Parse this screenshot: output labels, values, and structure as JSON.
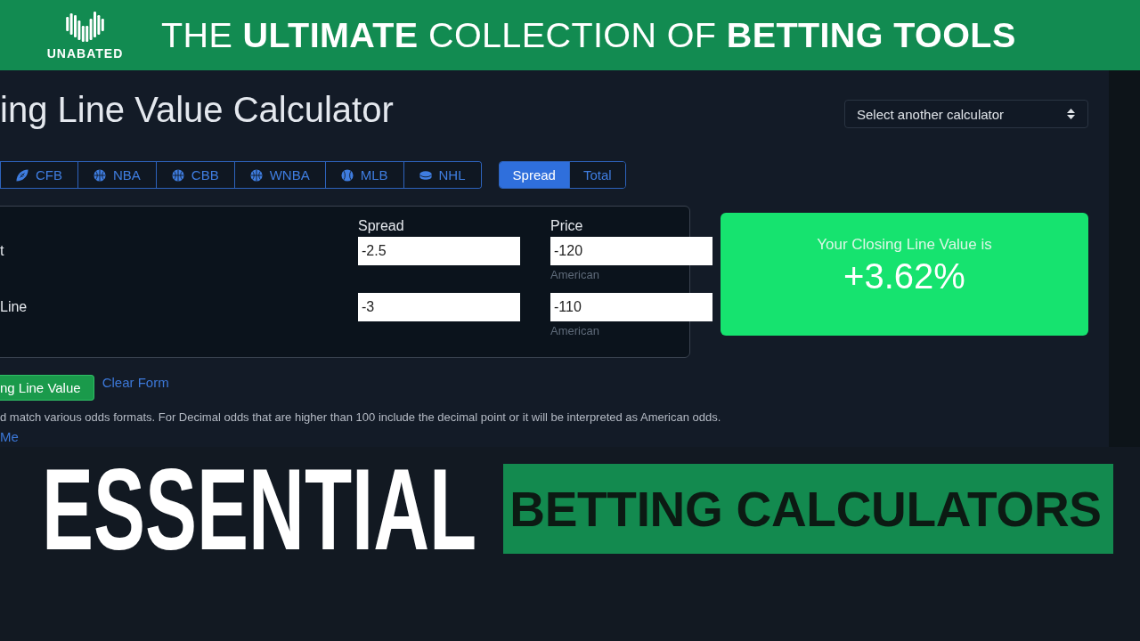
{
  "banner": {
    "logo_text": "UNABATED",
    "headline": "THE **ULTIMATE** COLLECTION OF **BETTING TOOLS**"
  },
  "calculator": {
    "title": "ing Line Value Calculator",
    "calculator_select": {
      "label": "Select another calculator"
    },
    "sport_tabs": [
      {
        "label": "CFB",
        "kind": "football",
        "selected": false
      },
      {
        "label": "NBA",
        "kind": "basketball",
        "selected": false
      },
      {
        "label": "CBB",
        "kind": "basketball",
        "selected": false
      },
      {
        "label": "WNBA",
        "kind": "basketball",
        "selected": false
      },
      {
        "label": "MLB",
        "kind": "baseball",
        "selected": false
      },
      {
        "label": "NHL",
        "kind": "puck",
        "selected": false
      }
    ],
    "market_tabs": [
      {
        "label": "Spread",
        "selected": true
      },
      {
        "label": "Total",
        "selected": false
      }
    ],
    "form": {
      "columns": [
        "Spread",
        "Price"
      ],
      "rows": [
        {
          "label": "t",
          "spread": "-2.5",
          "price": "-120",
          "price_hint": "American"
        },
        {
          "label": "Line",
          "spread": "-3",
          "price": "-110",
          "price_hint": "American"
        }
      ]
    },
    "calculate_button": "ng Line Value",
    "clear_link": "Clear Form",
    "note": "d match various odds formats. For Decimal odds that are higher than 100 include the decimal point or it will be interpreted as American odds.",
    "link": "Me"
  },
  "result": {
    "label": "Your Closing Line Value is",
    "value": "+3.62%"
  },
  "promo": {
    "title": "ESSENTIAL",
    "highlight": "BETTING CALCULATORS"
  }
}
